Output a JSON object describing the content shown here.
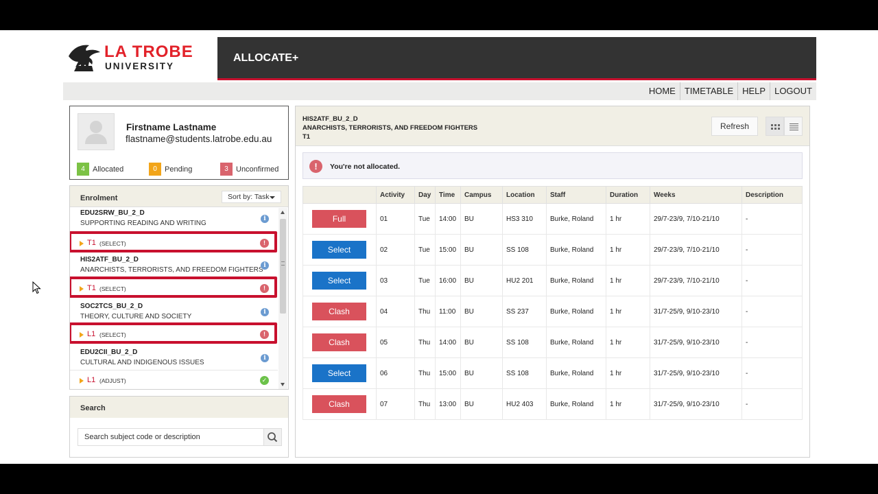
{
  "header": {
    "logo_line1": "LA TROBE",
    "logo_line2": "UNIVERSITY",
    "app_title": "ALLOCATE+"
  },
  "nav": [
    "HOME",
    "TIMETABLE",
    "HELP",
    "LOGOUT"
  ],
  "profile": {
    "name": "Firstname Lastname",
    "email": "flastname@students.latrobe.edu.au",
    "stats": [
      {
        "count": "4",
        "label": "Allocated",
        "color": "#7cc245"
      },
      {
        "count": "0",
        "label": "Pending",
        "color": "#f2a51a"
      },
      {
        "count": "3",
        "label": "Unconfirmed",
        "color": "#d9646d"
      }
    ]
  },
  "enrolment": {
    "title": "Enrolment",
    "sort_label": "Sort by: Task",
    "subjects": [
      {
        "code": "EDU2SRW_BU_2_D",
        "title": "SUPPORTING READING AND WRITING",
        "activity": "T1",
        "status": "(SELECT)",
        "state": "alert"
      },
      {
        "code": "HIS2ATF_BU_2_D",
        "title": "ANARCHISTS, TERRORISTS, AND FREEDOM FIGHTERS",
        "activity": "T1",
        "status": "(SELECT)",
        "state": "alert"
      },
      {
        "code": "SOC2TCS_BU_2_D",
        "title": "THEORY, CULTURE AND SOCIETY",
        "activity": "L1",
        "status": "(SELECT)",
        "state": "alert"
      },
      {
        "code": "EDU2CII_BU_2_D",
        "title": "CULTURAL AND INDIGENOUS ISSUES",
        "activity": "L1",
        "status": "(ADJUST)",
        "state": "ok"
      }
    ]
  },
  "search": {
    "title": "Search",
    "placeholder": "Search subject code or description"
  },
  "main": {
    "code": "HIS2ATF_BU_2_D",
    "name": "ANARCHISTS, TERRORISTS, AND FREEDOM FIGHTERS",
    "activity": "T1",
    "refresh_label": "Refresh",
    "alert": "You're not allocated.",
    "columns": [
      "",
      "Activity",
      "Day",
      "Time",
      "Campus",
      "Location",
      "Staff",
      "Duration",
      "Weeks",
      "Description"
    ],
    "rows": [
      {
        "action": "Full",
        "kind": "red",
        "activity": "01",
        "day": "Tue",
        "time": "14:00",
        "campus": "BU",
        "location": "HS3 310",
        "staff": "Burke, Roland",
        "duration": "1 hr",
        "weeks": "29/7-23/9, 7/10-21/10",
        "description": "-"
      },
      {
        "action": "Select",
        "kind": "blue",
        "activity": "02",
        "day": "Tue",
        "time": "15:00",
        "campus": "BU",
        "location": "SS 108",
        "staff": "Burke, Roland",
        "duration": "1 hr",
        "weeks": "29/7-23/9, 7/10-21/10",
        "description": "-"
      },
      {
        "action": "Select",
        "kind": "blue",
        "activity": "03",
        "day": "Tue",
        "time": "16:00",
        "campus": "BU",
        "location": "HU2 201",
        "staff": "Burke, Roland",
        "duration": "1 hr",
        "weeks": "29/7-23/9, 7/10-21/10",
        "description": "-"
      },
      {
        "action": "Clash",
        "kind": "red",
        "activity": "04",
        "day": "Thu",
        "time": "11:00",
        "campus": "BU",
        "location": "SS 237",
        "staff": "Burke, Roland",
        "duration": "1 hr",
        "weeks": "31/7-25/9, 9/10-23/10",
        "description": "-"
      },
      {
        "action": "Clash",
        "kind": "red",
        "activity": "05",
        "day": "Thu",
        "time": "14:00",
        "campus": "BU",
        "location": "SS 108",
        "staff": "Burke, Roland",
        "duration": "1 hr",
        "weeks": "31/7-25/9, 9/10-23/10",
        "description": "-"
      },
      {
        "action": "Select",
        "kind": "blue",
        "activity": "06",
        "day": "Thu",
        "time": "15:00",
        "campus": "BU",
        "location": "SS 108",
        "staff": "Burke, Roland",
        "duration": "1 hr",
        "weeks": "31/7-25/9, 9/10-23/10",
        "description": "-"
      },
      {
        "action": "Clash",
        "kind": "red",
        "activity": "07",
        "day": "Thu",
        "time": "13:00",
        "campus": "BU",
        "location": "HU2 403",
        "staff": "Burke, Roland",
        "duration": "1 hr",
        "weeks": "31/7-25/9, 9/10-23/10",
        "description": "-"
      }
    ]
  },
  "colors": {
    "brand_red": "#c8102e",
    "header_dark": "#333333",
    "action_blue": "#1a73c8",
    "action_red": "#d9525c",
    "panel_beige": "#f1efe5"
  }
}
